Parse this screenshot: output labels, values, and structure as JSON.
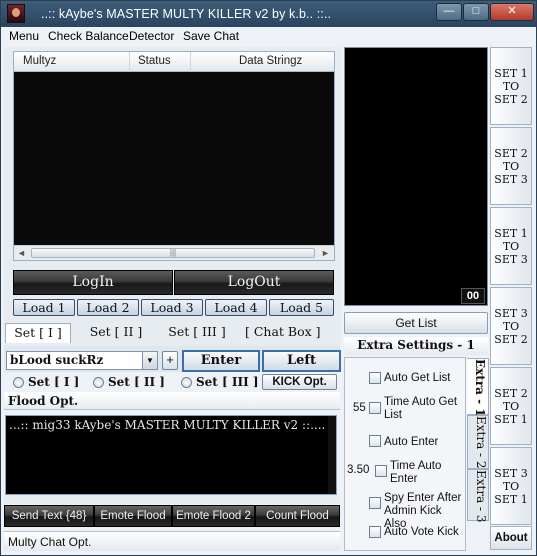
{
  "window": {
    "title": "..:: kAybe's MASTER MULTY KILLER v2 by  k.b..  ::..",
    "minimize_glyph": "—",
    "maximize_glyph": "□",
    "close_glyph": "✕"
  },
  "menu": [
    "Menu",
    "Check Balance",
    "Detector",
    "Save Chat"
  ],
  "list": {
    "columns": [
      "Multyz",
      "Status",
      "Data Stringz"
    ],
    "scroll_left": "◄",
    "scroll_right": "►",
    "scroll_grip": "|||"
  },
  "login_button": "LogIn",
  "logout_button": "LogOut",
  "load_buttons": [
    "Load 1",
    "Load 2",
    "Load 3",
    "Load 4",
    "Load 5"
  ],
  "tabs": [
    "Set  [ I ]",
    "Set  [ II ]",
    "Set  [ III ]",
    "[ Chat Box ]"
  ],
  "chat_controls": {
    "room_value": "bLood suckRz",
    "dropdown_glyph": "▼",
    "plus_label": "+",
    "enter_label": "Enter",
    "left_label": "Left"
  },
  "radio_sets": [
    "Set [ I ]",
    "Set [ II ]",
    "Set [ III ]"
  ],
  "kick_button": "KICK Opt.",
  "flood_header": "Flood Opt.",
  "chat_text": "...:: mig33 kAybe's MASTER MULTY KILLER v2 ::....",
  "flood_buttons": [
    "Send Text  {48}",
    "Emote Flood",
    "Emote Flood 2",
    "Count Flood"
  ],
  "multy_header": "Multy Chat Opt.",
  "counter": "00",
  "get_list_button": "Get List",
  "extra_settings_title": "Extra Settings - 1",
  "extra_options": {
    "auto_get_list": "Auto Get List",
    "time_auto_get_list_value": "55",
    "time_auto_get_list": "Time Auto Get List",
    "auto_enter": "Auto Enter",
    "time_auto_enter_value": "3.50",
    "time_auto_enter": "Time  Auto Enter",
    "spy_enter": "Spy Enter After Admin Kick Also",
    "auto_vote_kick": "Auto Vote Kick"
  },
  "vertical_tabs": [
    "Extra - 1",
    "Extra - 2",
    "Extra - 3"
  ],
  "set_buttons": [
    "SET 1\nTO\nSET 2",
    "SET 2\nTO\nSET 3",
    "SET 1\nTO\nSET 3",
    "SET 3\nTO\nSET 2",
    "SET 2\nTO\nSET 1",
    "SET 3\nTO\nSET 1"
  ],
  "about_button": "About"
}
